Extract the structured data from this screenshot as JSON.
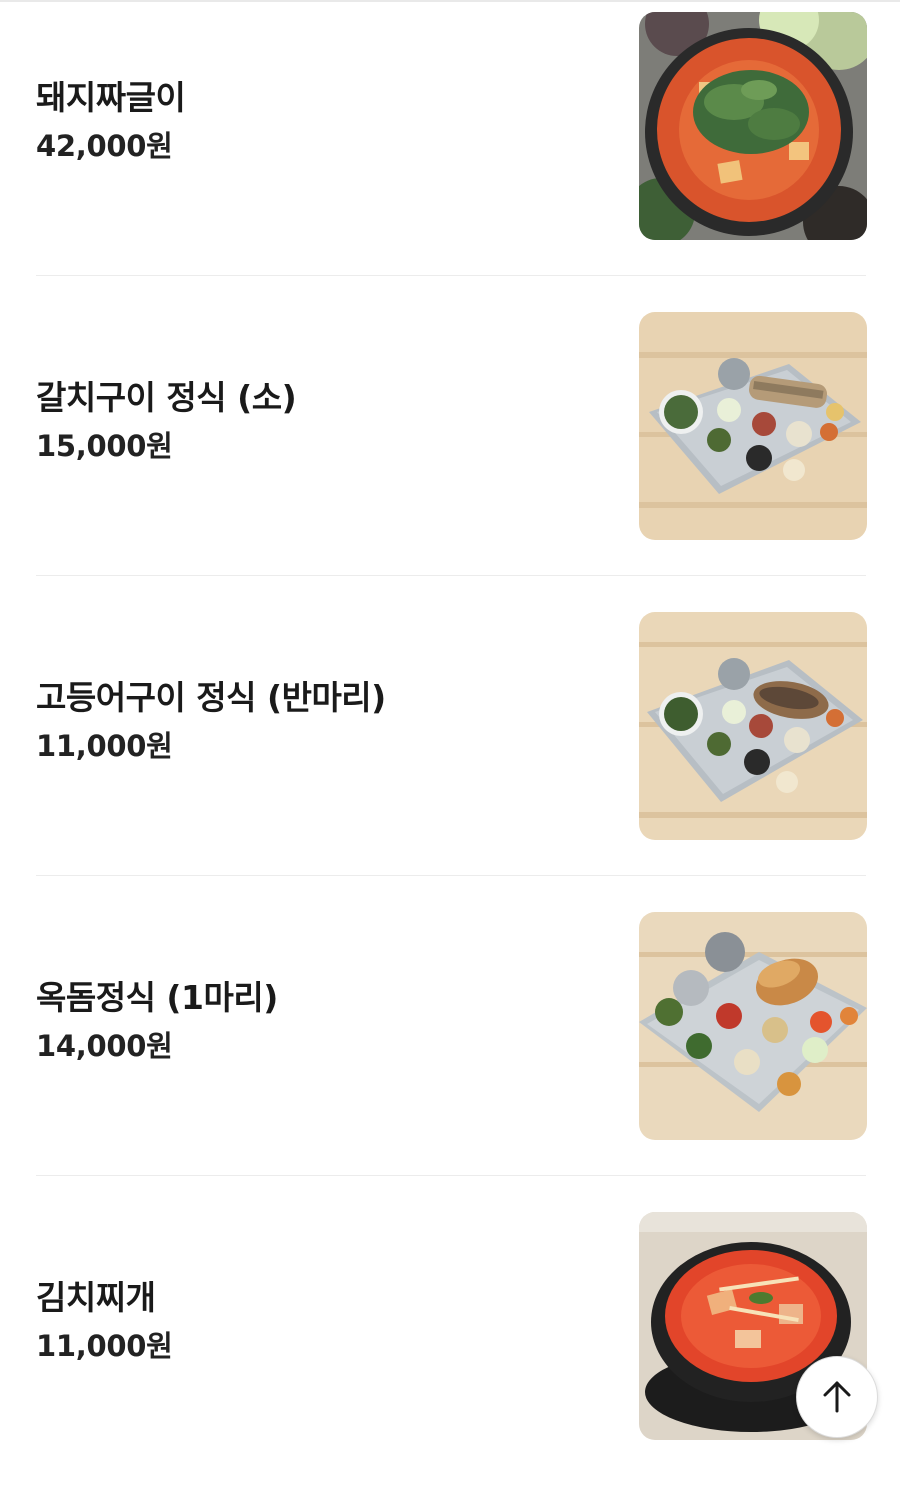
{
  "menu": {
    "items": [
      {
        "name": "돼지짜글이",
        "price": "42,000원",
        "photo": "pork-jjageuli-stew-photo"
      },
      {
        "name": "갈치구이 정식 (소)",
        "price": "15,000원",
        "photo": "grilled-hairtail-set-photo"
      },
      {
        "name": "고등어구이 정식 (반마리)",
        "price": "11,000원",
        "photo": "grilled-mackerel-set-photo"
      },
      {
        "name": "옥돔정식 (1마리)",
        "price": "14,000원",
        "photo": "red-tilefish-set-photo"
      },
      {
        "name": "김치찌개",
        "price": "11,000원",
        "photo": "kimchi-stew-photo"
      }
    ]
  },
  "scroll_top": {
    "icon": "arrow-up-icon"
  },
  "colors": {
    "text": "#1a1a1a",
    "divider": "#ececec",
    "background": "#ffffff"
  }
}
